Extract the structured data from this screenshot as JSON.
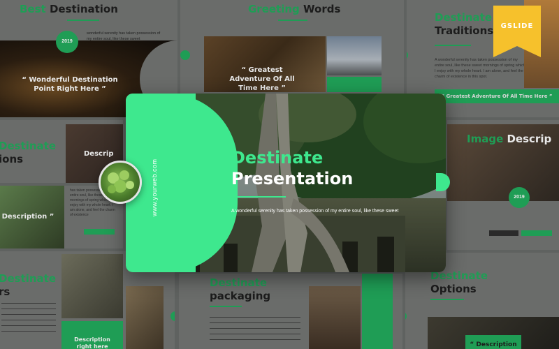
{
  "slides": {
    "best_destination": {
      "title_a": "Best",
      "title_b": "Destination",
      "year": "2019",
      "caption": "“ Wonderful Destination Point Right Here ”",
      "snippet": "wonderful serenity has taken possession of my entire soul, like these sweet"
    },
    "greeting_words": {
      "title_a": "Greeting",
      "title_b": "Words",
      "caption": "“ Greatest Adventure Of All Time Here ”"
    },
    "traditions": {
      "title_a": "Destinate",
      "title_b": "Traditions",
      "caption": "“ Greatest Adventure Of All Time Here ”",
      "body": "A wonderful serenity has taken possession of my entire soul, like these sweet mornings of spring which I enjoy with my whole heart. I am alone, and feel the charm of existence in this spot."
    },
    "left_mid": {
      "title_a": "Destinate",
      "title_b": "ions",
      "desc": "Descrip"
    },
    "left_lower": {
      "caption": "Description ”",
      "body": "has taken possession of my entire soul, like these sweet mornings of spring which I enjoy with my whole heart. I am alone, and feel the charm of existence"
    },
    "right_mid": {
      "title_a": "Image",
      "title_b": "Descrip",
      "year": "2019"
    },
    "bottom_left": {
      "title_a": "Destinate",
      "title_b": "rs",
      "caption": "Description right here"
    },
    "packaging": {
      "title_a": "Destinate",
      "title_b": "packaging"
    },
    "options": {
      "title_a": "Destinate",
      "title_b": "Options",
      "caption": "“ Description"
    }
  },
  "main": {
    "title_line1": "Destinate",
    "title_line2": "Presentation",
    "subtitle": "A wonderful serenity has taken possession of my entire soul, like these sweet",
    "url": "www.yourweb.com"
  },
  "badge": {
    "label": "GSLIDE"
  },
  "colors": {
    "accent_green": "#3ee88e",
    "dark_green": "#1f9d55",
    "badge_yellow": "#f6c12c"
  }
}
